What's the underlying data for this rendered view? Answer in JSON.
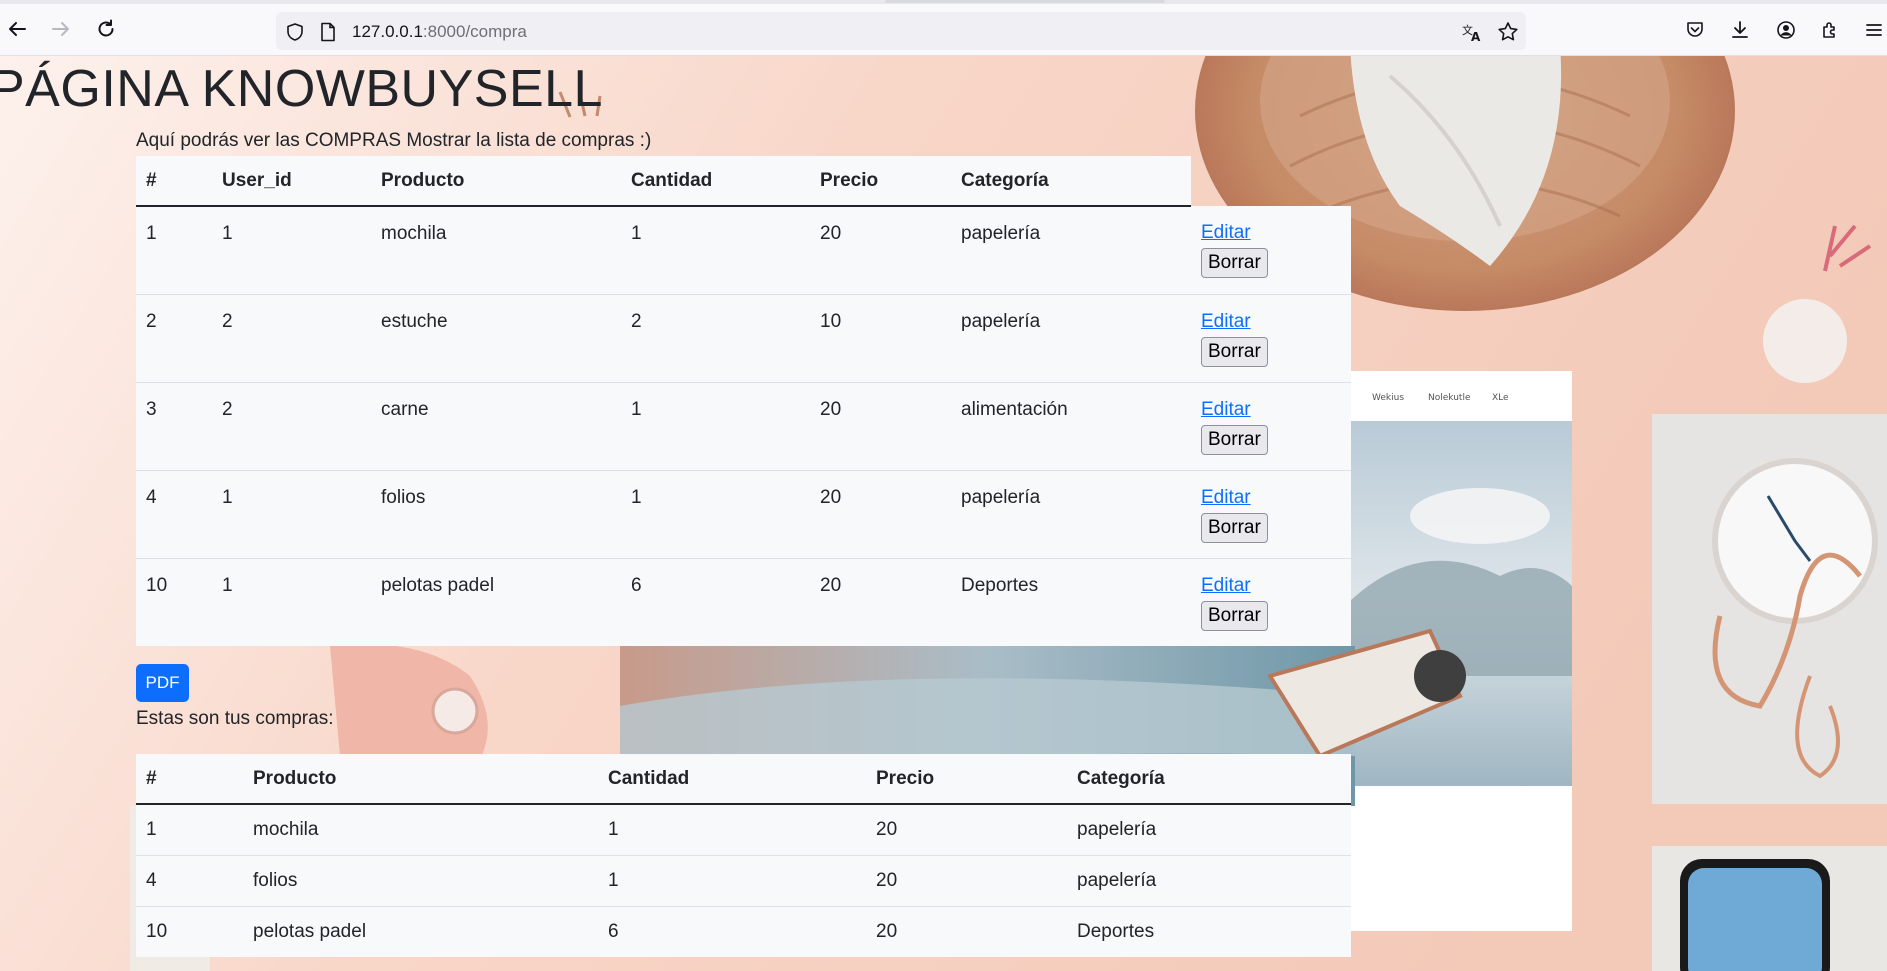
{
  "browser": {
    "url_host": "127.0.0.1",
    "url_rest": ":8000/compra",
    "icons": [
      "back-icon",
      "forward-icon",
      "reload-icon",
      "shield-icon",
      "page-icon",
      "translate-icon",
      "star-icon",
      "pocket-icon",
      "download-icon",
      "account-icon",
      "extensions-icon",
      "menu-icon"
    ]
  },
  "page": {
    "title": "PÁGINA KNOWBUYSELL",
    "intro": "Aquí podrás ver las COMPRAS Mostrar la lista de compras :)",
    "purchases_table": {
      "headers": [
        "#",
        "User_id",
        "Producto",
        "Cantidad",
        "Precio",
        "Categoría"
      ],
      "edit_label": "Editar",
      "delete_label": "Borrar",
      "rows": [
        {
          "id": "1",
          "user_id": "1",
          "producto": "mochila",
          "cantidad": "1",
          "precio": "20",
          "categoria": "papelería"
        },
        {
          "id": "2",
          "user_id": "2",
          "producto": "estuche",
          "cantidad": "2",
          "precio": "10",
          "categoria": "papelería"
        },
        {
          "id": "3",
          "user_id": "2",
          "producto": "carne",
          "cantidad": "1",
          "precio": "20",
          "categoria": "alimentación"
        },
        {
          "id": "4",
          "user_id": "1",
          "producto": "folios",
          "cantidad": "1",
          "precio": "20",
          "categoria": "papelería"
        },
        {
          "id": "10",
          "user_id": "1",
          "producto": "pelotas padel",
          "cantidad": "6",
          "precio": "20",
          "categoria": "Deportes"
        }
      ]
    },
    "pdf_label": "PDF",
    "my_purchases_label": "Estas son tus compras:",
    "my_purchases_table": {
      "headers": [
        "#",
        "Producto",
        "Cantidad",
        "Precio",
        "Categoría"
      ],
      "rows": [
        {
          "id": "1",
          "producto": "mochila",
          "cantidad": "1",
          "precio": "20",
          "categoria": "papelería"
        },
        {
          "id": "4",
          "producto": "folios",
          "cantidad": "1",
          "precio": "20",
          "categoria": "papelería"
        },
        {
          "id": "10",
          "producto": "pelotas padel",
          "cantidad": "6",
          "precio": "20",
          "categoria": "Deportes"
        }
      ]
    }
  },
  "colors": {
    "primary": "#0d6efd",
    "link": "#0d6efd",
    "table_bg": "#f8f9fa",
    "text": "#212529"
  }
}
